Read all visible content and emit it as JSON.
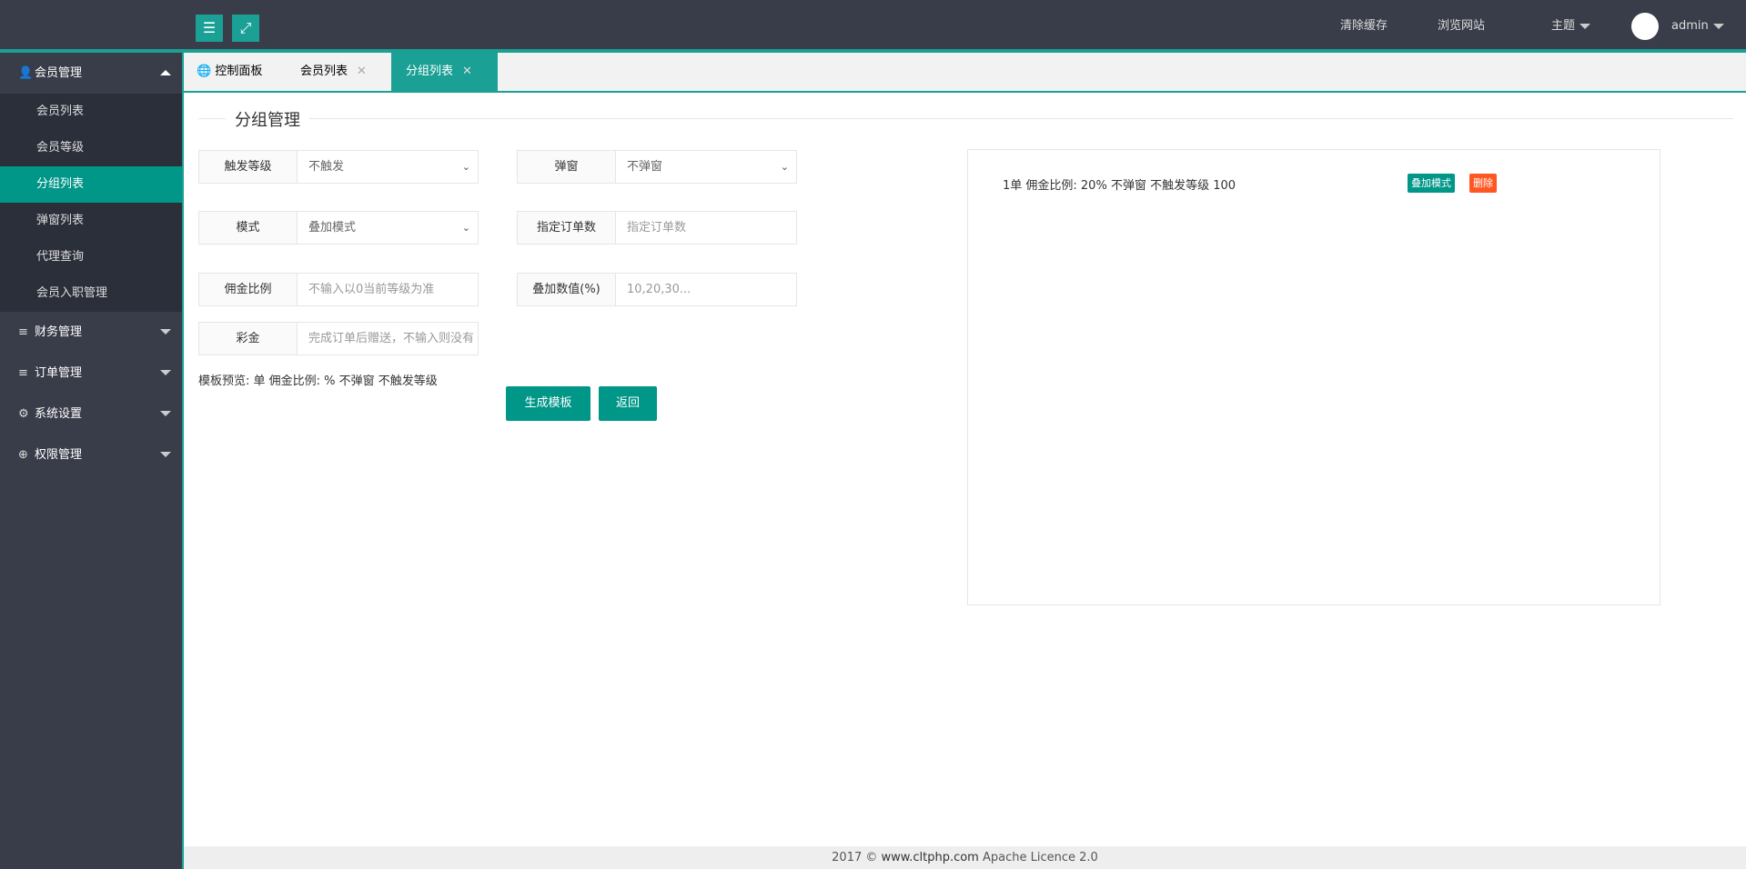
{
  "header": {
    "menu_icon": "list-icon",
    "fullscreen_icon": "expand-icon",
    "clear_cache": "清除缓存",
    "browse_site": "浏览网站",
    "theme": "主题",
    "user": "admin"
  },
  "sidebar": {
    "groups": [
      {
        "label": "会员管理",
        "icon": "user-icon",
        "expanded": true,
        "items": [
          {
            "label": "会员列表"
          },
          {
            "label": "会员等级"
          },
          {
            "label": "分组列表",
            "active": true
          },
          {
            "label": "弹窗列表"
          },
          {
            "label": "代理查询"
          },
          {
            "label": "会员入职管理"
          }
        ]
      },
      {
        "label": "财务管理",
        "icon": "database-icon"
      },
      {
        "label": "订单管理",
        "icon": "database-icon"
      },
      {
        "label": "系统设置",
        "icon": "gear-icon"
      },
      {
        "label": "权限管理",
        "icon": "globe-icon"
      }
    ]
  },
  "tabs": [
    {
      "label": "控制面板",
      "icon": "globe-icon"
    },
    {
      "label": "会员列表"
    },
    {
      "label": "分组列表",
      "active": true
    }
  ],
  "form": {
    "title": "分组管理",
    "trigger_level": {
      "label": "触发等级",
      "value": "不触发"
    },
    "popup": {
      "label": "弹窗",
      "value": "不弹窗"
    },
    "mode": {
      "label": "模式",
      "value": "叠加模式"
    },
    "order_count": {
      "label": "指定订单数",
      "placeholder": "指定订单数"
    },
    "commission": {
      "label": "佣金比例",
      "placeholder": "不输入以0当前等级为准"
    },
    "stack_value": {
      "label": "叠加数值(%)",
      "placeholder": "10,20,30..."
    },
    "bonus": {
      "label": "彩金",
      "placeholder": "完成订单后赠送，不输入则没有"
    },
    "preview": "模板预览: 单 佣金比例: % 不弹窗 不触发等级",
    "generate": "生成模板",
    "back": "返回"
  },
  "list": {
    "items": [
      {
        "text": "1单 佣金比例: 20% 不弹窗 不触发等级 100",
        "mode_badge": "叠加模式",
        "delete": "删除"
      }
    ]
  },
  "colors": {
    "accent": "#009688",
    "danger": "#ff5722",
    "topbar": "#393d49"
  },
  "footer": {
    "year": "2017 ©",
    "site": "www.cltphp.com",
    "licence": "Apache Licence 2.0"
  }
}
